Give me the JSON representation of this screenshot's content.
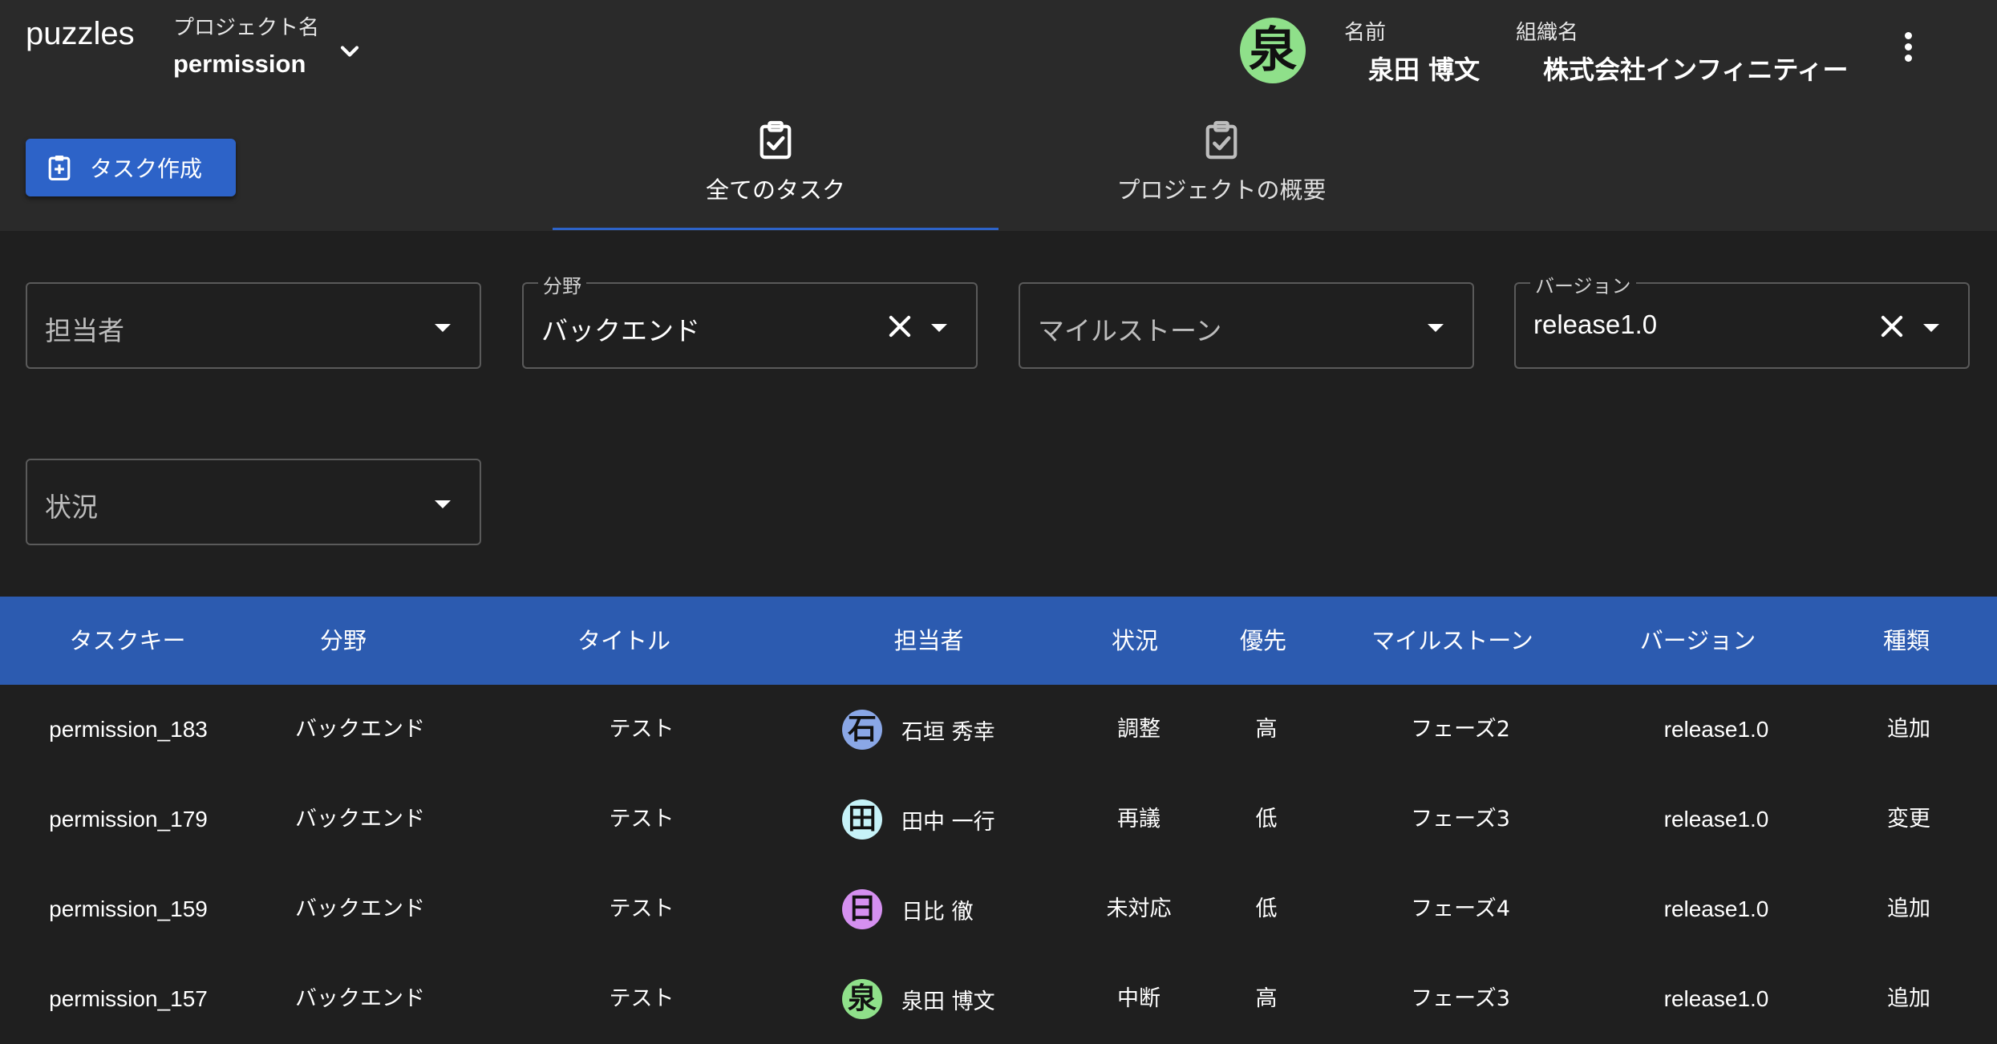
{
  "header": {
    "brand": "puzzles",
    "project_caption": "プロジェクト名",
    "project_name": "permission",
    "name_caption": "名前",
    "user_name": "泉田 博文",
    "user_initial": "泉",
    "org_caption": "組織名",
    "org_name": "株式会社インフィニティー",
    "user_avatar_color": "#8fe08a",
    "icons": {
      "project_dropdown": "chevron-down-icon",
      "menu": "more-vertical-icon"
    }
  },
  "toolbar": {
    "create_label": "タスク作成",
    "create_icon": "clipboard-plus-icon",
    "accent_color": "#2d63c8"
  },
  "tabs": [
    {
      "label": "全てのタスク",
      "icon": "clipboard-check-icon",
      "active": true
    },
    {
      "label": "プロジェクトの概要",
      "icon": "clipboard-check-icon",
      "active": false
    }
  ],
  "filters": {
    "assignee": {
      "placeholder": "担当者",
      "value": ""
    },
    "field": {
      "label": "分野",
      "value": "バックエンド"
    },
    "milestone": {
      "placeholder": "マイルストーン",
      "value": ""
    },
    "version": {
      "label": "バージョン",
      "value": "release1.0"
    },
    "status": {
      "placeholder": "状況",
      "value": ""
    }
  },
  "table": {
    "header_color": "#2c5bb0",
    "columns": [
      "タスクキー",
      "分野",
      "タイトル",
      "担当者",
      "状況",
      "優先",
      "マイルストーン",
      "バージョン",
      "種類"
    ],
    "rows": [
      {
        "key": "permission_183",
        "field": "バックエンド",
        "title": "テスト",
        "assignee": "石垣 秀幸",
        "initial": "石",
        "avatar_color": "#8aa7e6",
        "status": "調整",
        "priority": "高",
        "milestone": "フェーズ2",
        "version": "release1.0",
        "type": "追加"
      },
      {
        "key": "permission_179",
        "field": "バックエンド",
        "title": "テスト",
        "assignee": "田中 一行",
        "initial": "田",
        "avatar_color": "#c6f2f8",
        "status": "再議",
        "priority": "低",
        "milestone": "フェーズ3",
        "version": "release1.0",
        "type": "変更"
      },
      {
        "key": "permission_159",
        "field": "バックエンド",
        "title": "テスト",
        "assignee": "日比 徹",
        "initial": "日",
        "avatar_color": "#d590f0",
        "status": "未対応",
        "priority": "低",
        "milestone": "フェーズ4",
        "version": "release1.0",
        "type": "追加"
      },
      {
        "key": "permission_157",
        "field": "バックエンド",
        "title": "テスト",
        "assignee": "泉田 博文",
        "initial": "泉",
        "avatar_color": "#8fe08a",
        "status": "中断",
        "priority": "高",
        "milestone": "フェーズ3",
        "version": "release1.0",
        "type": "追加"
      }
    ]
  }
}
